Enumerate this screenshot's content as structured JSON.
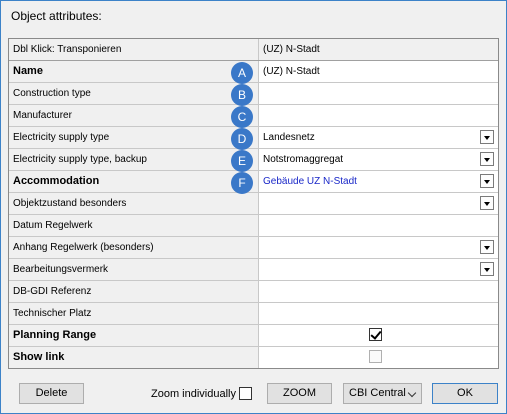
{
  "window": {
    "title": "Object attributes:"
  },
  "table": {
    "header": {
      "label": "Dbl Klick: Transponieren",
      "value": "(UZ) N-Stadt"
    },
    "rows": [
      {
        "label": "Name",
        "bold": true,
        "badge": "A",
        "value": "(UZ) N-Stadt",
        "control": "text"
      },
      {
        "label": "Construction type",
        "bold": false,
        "badge": "B",
        "value": "",
        "control": "text"
      },
      {
        "label": "Manufacturer",
        "bold": false,
        "badge": "C",
        "value": "",
        "control": "text"
      },
      {
        "label": "Electricity supply type",
        "bold": false,
        "badge": "D",
        "value": "Landesnetz",
        "control": "dropdown"
      },
      {
        "label": "Electricity supply type, backup",
        "bold": false,
        "badge": "E",
        "value": "Notstromaggregat",
        "control": "dropdown"
      },
      {
        "label": "Accommodation",
        "bold": true,
        "badge": "F",
        "value": "Gebäude UZ N-Stadt",
        "control": "dropdown",
        "link": true
      },
      {
        "label": "Objektzustand besonders",
        "bold": false,
        "value": "",
        "control": "dropdown"
      },
      {
        "label": "Datum Regelwerk",
        "bold": false,
        "value": "",
        "control": "text"
      },
      {
        "label": "Anhang Regelwerk (besonders)",
        "bold": false,
        "value": "",
        "control": "dropdown"
      },
      {
        "label": "Bearbeitungsvermerk",
        "bold": false,
        "value": "",
        "control": "dropdown"
      },
      {
        "label": "DB-GDI Referenz",
        "bold": false,
        "value": "",
        "control": "text"
      },
      {
        "label": "Technischer Platz",
        "bold": false,
        "value": "",
        "control": "text"
      },
      {
        "label": "Planning Range",
        "bold": true,
        "value": "",
        "control": "checkbox",
        "checked": true
      },
      {
        "label": "Show link",
        "bold": true,
        "value": "",
        "control": "checkbox",
        "checked": false,
        "disabled": true
      }
    ]
  },
  "footer": {
    "delete_label": "Delete",
    "zoom_individually_label": "Zoom individually",
    "zoom_individually_checked": false,
    "zoom_label": "ZOOM",
    "select_value": "CBI Central",
    "ok_label": "OK"
  },
  "colors": {
    "badge": "#3a78c8",
    "link": "#1a28c8",
    "window_border": "#3c82c8"
  }
}
